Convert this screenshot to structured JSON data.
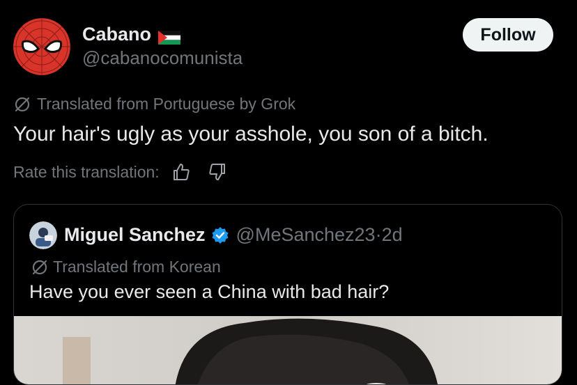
{
  "author": {
    "display_name": "Cabano",
    "flag": "palestine-flag",
    "handle": "@cabanocomunista",
    "avatar": "spiderman-mask-avatar"
  },
  "follow_label": "Follow",
  "translation": {
    "label": "Translated from Portuguese by Grok",
    "icon": "translate-icon"
  },
  "tweet_text": "Your hair's ugly as your asshole, you son of a bitch.",
  "rate": {
    "label": "Rate this translation:",
    "up_icon": "thumbs-up-icon",
    "down_icon": "thumbs-down-icon"
  },
  "quote": {
    "name": "Miguel Sanchez",
    "handle": "@MeSanchez23",
    "separator": " · ",
    "age": "2d",
    "translated_label": "Translated from Korean",
    "text": "Have you ever seen a China with bad hair?"
  },
  "colors": {
    "background": "#000000",
    "text_primary": "#e7e9ea",
    "text_secondary": "#71767b",
    "follow_bg": "#eff3f4",
    "verified": "#1d9bf0",
    "border": "#2f3336"
  }
}
